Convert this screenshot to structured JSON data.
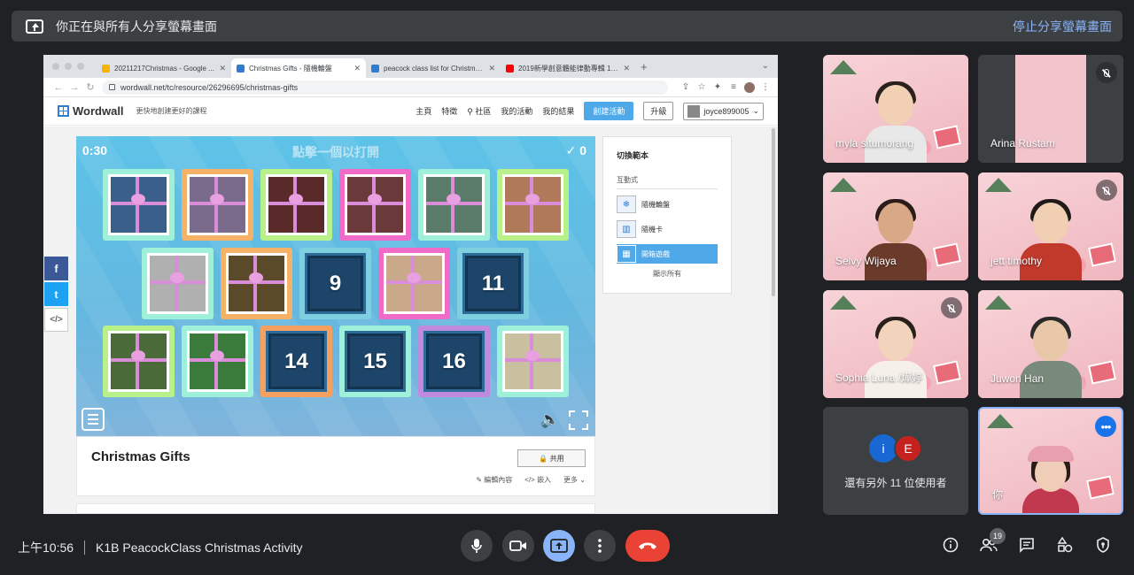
{
  "banner": {
    "message": "你正在與所有人分享螢幕畫面",
    "stop_label": "停止分享螢幕畫面"
  },
  "browser": {
    "tabs": [
      {
        "label": "20211217Christmas - Google ...",
        "fav_color": "#f4b400"
      },
      {
        "label": "Christmas Gifts - 隨機輪盤",
        "fav_color": "#2e7dd1"
      },
      {
        "label": "peacock class list for Christma...",
        "fav_color": "#2e7dd1"
      },
      {
        "label": "2019新學創意體能律動專輯 10 ...",
        "fav_color": "#ff0000"
      }
    ],
    "url": "wordwall.net/tc/resource/26296695/christmas-gifts"
  },
  "wordwall": {
    "logo": "Wordwall",
    "tagline": "更快地創建更好的課程",
    "nav": [
      "主頁",
      "特徵",
      "社區",
      "我的活動",
      "我的結果"
    ],
    "create_label": "創建活動",
    "upgrade_label": "升級",
    "username": "joyce899005"
  },
  "game": {
    "timer": "0:30",
    "instruction": "點擊一個以打開",
    "score": "0",
    "boxes": [
      {
        "row": 0,
        "label": "",
        "frame": "#9ff0d8",
        "wrap": "#3a5f8a"
      },
      {
        "row": 0,
        "label": "",
        "frame": "#f5b266",
        "wrap": "#7a6a8c"
      },
      {
        "row": 0,
        "label": "",
        "frame": "#b8f08a",
        "wrap": "#5a2a2a"
      },
      {
        "row": 0,
        "label": "",
        "frame": "#f06ac8",
        "wrap": "#6a3a3a"
      },
      {
        "row": 0,
        "label": "",
        "frame": "#9ff0d8",
        "wrap": "#5a7a6a"
      },
      {
        "row": 0,
        "label": "",
        "frame": "#b8f08a",
        "wrap": "#b07a5a"
      },
      {
        "row": 1,
        "label": "",
        "frame": "#9ff0d8",
        "wrap": "#b0b0b0"
      },
      {
        "row": 1,
        "label": "",
        "frame": "#f5b266",
        "wrap": "#5a4a2a"
      },
      {
        "row": 1,
        "label": "9",
        "frame": "#7ecfe0",
        "wrap": ""
      },
      {
        "row": 1,
        "label": "",
        "frame": "#f06ac8",
        "wrap": "#c9a98a"
      },
      {
        "row": 1,
        "label": "11",
        "frame": "#7ecfe0",
        "wrap": ""
      },
      {
        "row": 2,
        "label": "",
        "frame": "#b8f08a",
        "wrap": "#4a6a3a"
      },
      {
        "row": 2,
        "label": "",
        "frame": "#9ff0d8",
        "wrap": "#3a7a3a"
      },
      {
        "row": 2,
        "label": "14",
        "frame": "#f5a060",
        "wrap": ""
      },
      {
        "row": 2,
        "label": "15",
        "frame": "#9ff0d8",
        "wrap": ""
      },
      {
        "row": 2,
        "label": "16",
        "frame": "#c08ae0",
        "wrap": ""
      },
      {
        "row": 2,
        "label": "",
        "frame": "#9ff0d8",
        "wrap": "#c9c0a0"
      }
    ]
  },
  "template_panel": {
    "title": "切換範本",
    "subtitle": "互動式",
    "items": [
      {
        "label": "隨機輪盤",
        "active": false
      },
      {
        "label": "隨機卡",
        "active": false
      },
      {
        "label": "開箱遊戲",
        "active": true
      }
    ],
    "show_all": "顯示所有"
  },
  "activity": {
    "title": "Christmas Gifts",
    "share_label": "共用",
    "edit_label": "編輯內容",
    "embed_label": "嵌入",
    "more_label": "更多"
  },
  "participants": [
    {
      "name": "myla situmorang",
      "muted": false,
      "shirt": "#e8e8e8",
      "skin": "#f2d0b4",
      "hair": "#2a211c"
    },
    {
      "name": "Arina Rustam",
      "muted": true,
      "shirt": "",
      "skin": "",
      "hair": ""
    },
    {
      "name": "Selvy Wijaya",
      "muted": false,
      "shirt": "#6a3a2a",
      "skin": "#d9a886",
      "hair": "#2a1d18"
    },
    {
      "name": "jett timothy",
      "muted": true,
      "shirt": "#c0392b",
      "skin": "#f0cfb2",
      "hair": "#1e1a18"
    },
    {
      "name": "Sophia Luna /燁婷",
      "muted": true,
      "shirt": "#f5f0ea",
      "skin": "#f2d3bb",
      "hair": "#2a201b"
    },
    {
      "name": "Juwon Han",
      "muted": false,
      "shirt": "#7a8a7a",
      "skin": "#e8c8a8",
      "hair": "#2a2a2a"
    }
  ],
  "others": {
    "avatars": [
      "i",
      "E"
    ],
    "text": "還有另外 11 位使用者"
  },
  "self": {
    "name": "你"
  },
  "meeting": {
    "time": "上午10:56",
    "title": "K1B PeacockClass Christmas Activity",
    "participant_count": "19"
  }
}
